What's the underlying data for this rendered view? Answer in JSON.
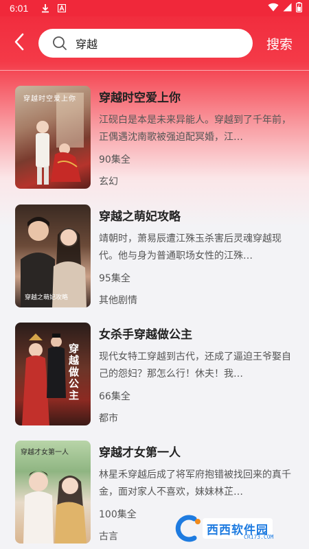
{
  "status_bar": {
    "time": "6:01"
  },
  "search": {
    "query": "穿越",
    "button_label": "搜索"
  },
  "results": [
    {
      "title": "穿越时空爱上你",
      "description": "江砚白是本是未来异能人。穿越到了千年前，正偶遇沈南歌被强迫配冥婚，江…",
      "episodes": "90集全",
      "genre": "玄幻",
      "cover_text": "穿越时空爱上你"
    },
    {
      "title": "穿越之萌妃攻略",
      "description": "靖朝时，萧易辰遭江殊玉杀害后灵魂穿越现代。他与身为普通职场女性的江殊…",
      "episodes": "95集全",
      "genre": "其他剧情",
      "cover_text": "穿越之萌妃攻略"
    },
    {
      "title": "女杀手穿越做公主",
      "description": "现代女特工穿越到古代，还成了逼迫王爷娶自己的怨妇？那怎么行！休夫！我…",
      "episodes": "66集全",
      "genre": "都市",
      "cover_text": "穿越做公主"
    },
    {
      "title": "穿越才女第一人",
      "description": "林星禾穿越后成了将军府抱错被找回来的真千金，面对家人不喜欢，妹妹林芷…",
      "episodes": "100集全",
      "genre": "古言",
      "cover_text": "穿越才女第一人"
    }
  ],
  "watermark": {
    "name": "西西软件园",
    "url": "CR173.COM"
  },
  "colors": {
    "accent": "#f0283a",
    "background": "#f3f3f6"
  }
}
